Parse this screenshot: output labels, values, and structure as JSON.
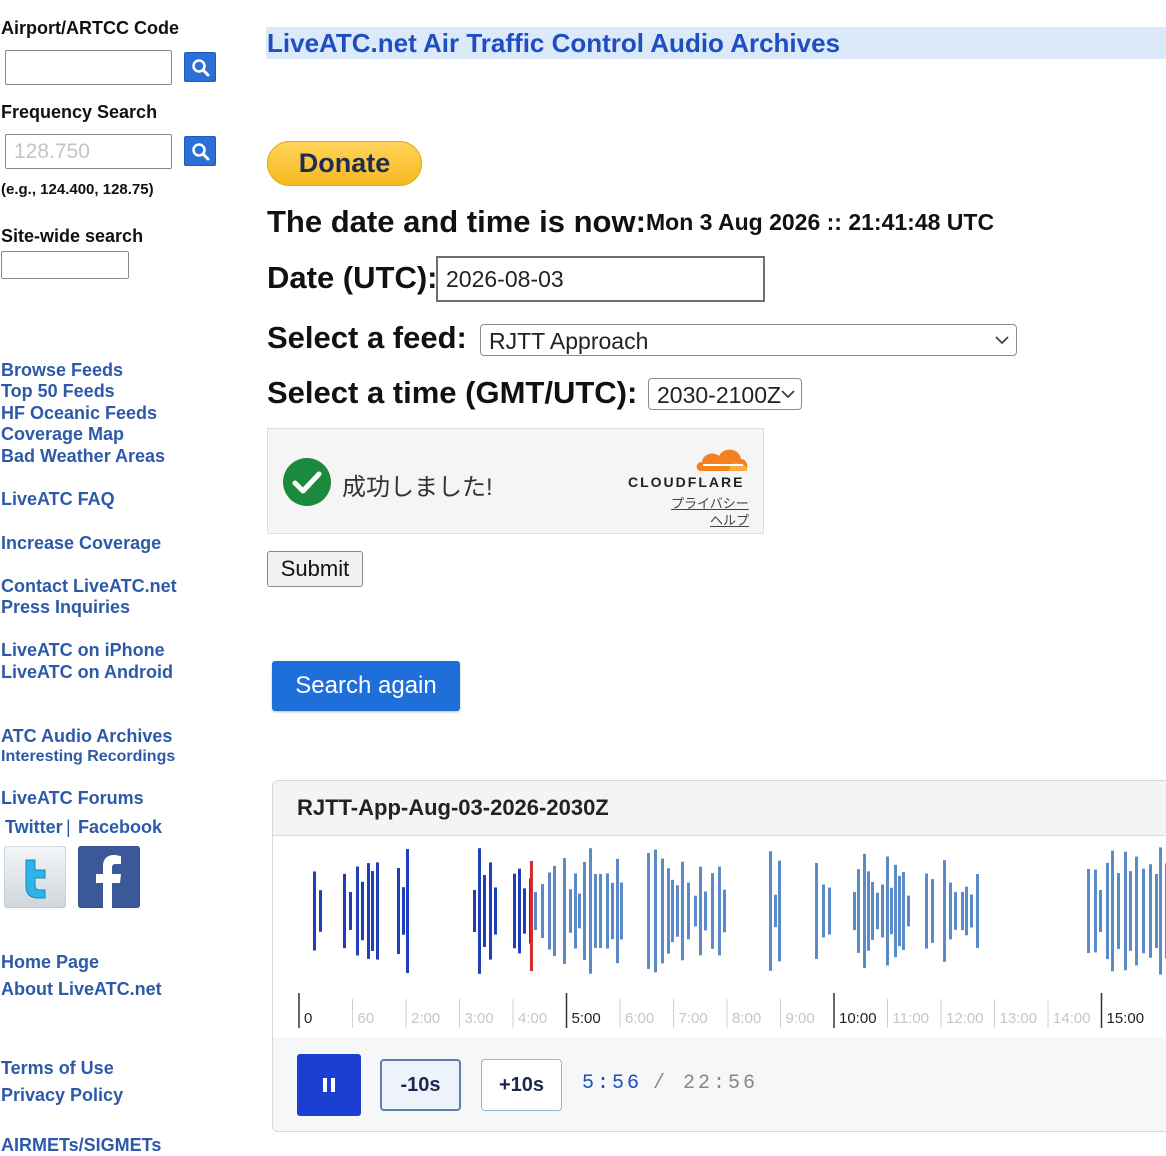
{
  "sidebar": {
    "airport_label": "Airport/ARTCC Code",
    "airport_value": "",
    "frequency_label": "Frequency Search",
    "frequency_placeholder": "128.750",
    "frequency_hint": "(e.g., 124.400, 128.75)",
    "sitewide_label": "Site-wide search",
    "links": {
      "browse": "Browse Feeds",
      "top50": "Top 50 Feeds",
      "hf": "HF Oceanic Feeds",
      "coverage_map": "Coverage Map",
      "bad_weather": "Bad Weather Areas",
      "faq": "LiveATC FAQ",
      "increase": "Increase Coverage",
      "contact": "Contact LiveATC.net",
      "press": "Press Inquiries",
      "iphone": "LiveATC on iPhone",
      "android": "LiveATC on Android",
      "archives": "ATC Audio Archives",
      "interesting": "Interesting Recordings",
      "forums": "LiveATC Forums",
      "twitter": "Twitter",
      "separator": "|",
      "facebook": "Facebook",
      "home": "Home Page",
      "about": "About LiveATC.net",
      "terms": "Terms of Use",
      "privacy": "Privacy Policy",
      "airmets": "AIRMETs/SIGMETs"
    }
  },
  "main": {
    "title": "LiveATC.net Air Traffic Control Audio Archives",
    "donate_label": "Donate",
    "now_label": "The date and time is now:",
    "now_value": "Mon 3 Aug 2026 :: 21:41:48 UTC",
    "date_label": "Date (UTC):",
    "date_value": "2026-08-03",
    "feed_label": "Select a feed:",
    "feed_value": "RJTT Approach",
    "time_label": "Select a time (GMT/UTC):",
    "time_value": "2030-2100Z",
    "captcha": {
      "status": "成功しました!",
      "brand": "CLOUDFLARE",
      "privacy": "プライバシー",
      "help": "ヘルプ"
    },
    "submit_label": "Submit",
    "search_again_label": "Search again"
  },
  "player": {
    "title": "RJTT-App-Aug-03-2026-2030Z",
    "skip_back": "-10s",
    "skip_forward": "+10s",
    "current_time": "5:56",
    "time_separator": "/",
    "total_time": "22:56",
    "progress": 0.26,
    "timeline_ticks": [
      "0",
      "60",
      "2:00",
      "3:00",
      "4:00",
      "5:00",
      "6:00",
      "7:00",
      "8:00",
      "9:00",
      "10:00",
      "11:00",
      "12:00",
      "13:00",
      "14:00",
      "15:00"
    ],
    "major_ticks": [
      "0",
      "5:00",
      "10:00",
      "15:00"
    ],
    "played_color": "#1f3fb8",
    "unplayed_color": "#5b8ac9",
    "cursor_color": "#d62a2a"
  },
  "colors": {
    "link": "#2d5aa8",
    "title": "#1d4fc2",
    "title_bar": "#dce9f8",
    "button_blue": "#1f6fdb"
  },
  "icons": {
    "search_button": "magnifier-icon",
    "twitter": "twitter-icon",
    "facebook": "facebook-icon",
    "captcha_check": "check-circle-icon",
    "pause": "pause-icon"
  }
}
